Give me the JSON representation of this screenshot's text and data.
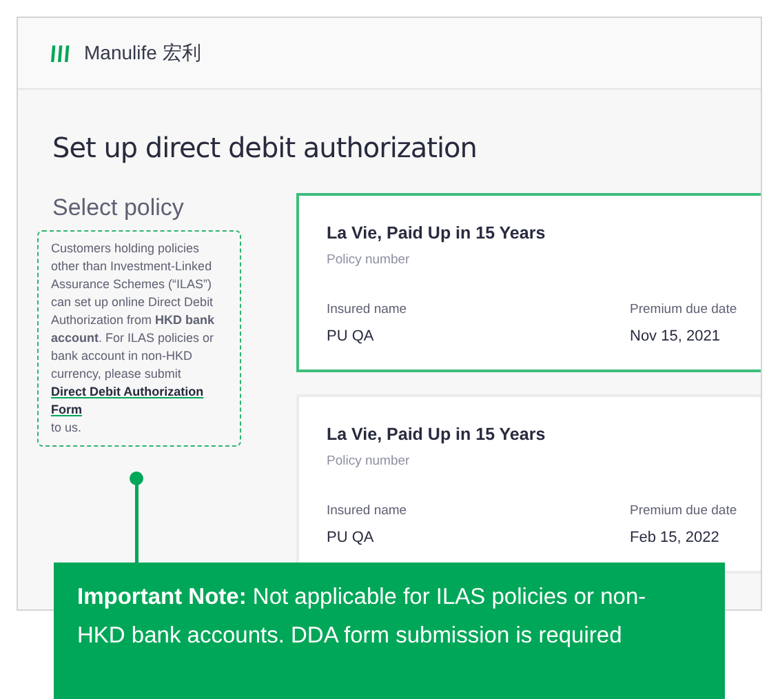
{
  "header": {
    "brand": "Manulife 宏利"
  },
  "title": "Set up direct debit authorization",
  "section_title": "Select policy",
  "info": {
    "text": "Customers holding policies other than Investment-Linked Assurance Schemes (“ILAS”) can set up online Direct Debit Authorization from **HKD bank account**. For ILAS policies or bank account in non-HKD currency, please submit",
    "link": "Direct Debit Authorization Form",
    "text_after": "to us."
  },
  "policies": [
    {
      "name": "La Vie, Paid Up in 15 Years",
      "number_label": "Policy number",
      "insured_label": "Insured name",
      "insured": "PU QA",
      "due_label": "Premium due date",
      "due": "Nov 15, 2021",
      "selected": true
    },
    {
      "name": "La Vie, Paid Up in 15 Years",
      "number_label": "Policy number",
      "insured_label": "Insured name",
      "insured": "PU QA",
      "due_label": "Premium due date",
      "due": "Feb 15, 2022",
      "selected": false
    }
  ],
  "note": "**Important Note:** Not applicable for ILAS policies or non-HKD bank accounts. DDA form submission is required"
}
